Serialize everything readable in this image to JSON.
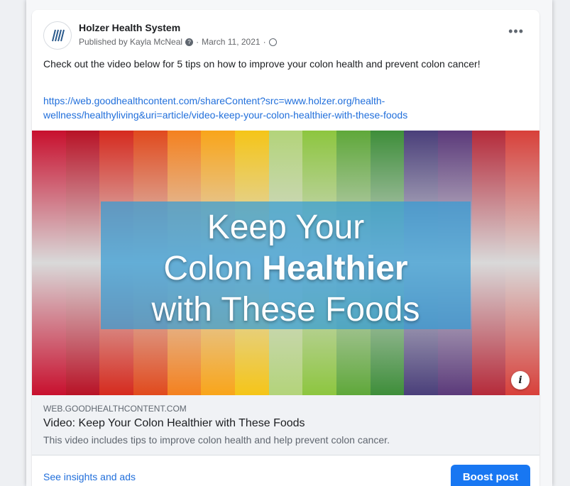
{
  "post": {
    "page_name": "Holzer Health System",
    "published_by": "Published by Kayla McNeal",
    "date": "March 11, 2021",
    "text": "Check out the video below for 5 tips on how to improve your colon health and prevent colon cancer!",
    "link": "https://web.goodhealthcontent.com/shareContent?src=www.holzer.org/health-wellness/healthyliving&uri=article/video-keep-your-colon-healthier-with-these-foods",
    "more_label": "•••"
  },
  "image": {
    "headline_line1": "Keep Your",
    "headline_line2_a": "Colon ",
    "headline_line2_b": "Healthier",
    "headline_line3": "with These Foods",
    "info_label": "i",
    "strip_colors": [
      "#c8102e",
      "#b81226",
      "#d62a1e",
      "#e14a1d",
      "#f4811f",
      "#f9a51a",
      "#f5c518",
      "#b3d47a",
      "#8dc63f",
      "#5fa83a",
      "#3e8e3a",
      "#4a3f7a",
      "#5b3a7a",
      "#b52a3a",
      "#d8403a"
    ]
  },
  "preview": {
    "domain": "WEB.GOODHEALTHCONTENT.COM",
    "title": "Video: Keep Your Colon Healthier with These Foods",
    "description": "This video includes tips to improve colon health and help prevent colon cancer."
  },
  "footer": {
    "insights_label": "See insights and ads",
    "boost_label": "Boost post"
  }
}
